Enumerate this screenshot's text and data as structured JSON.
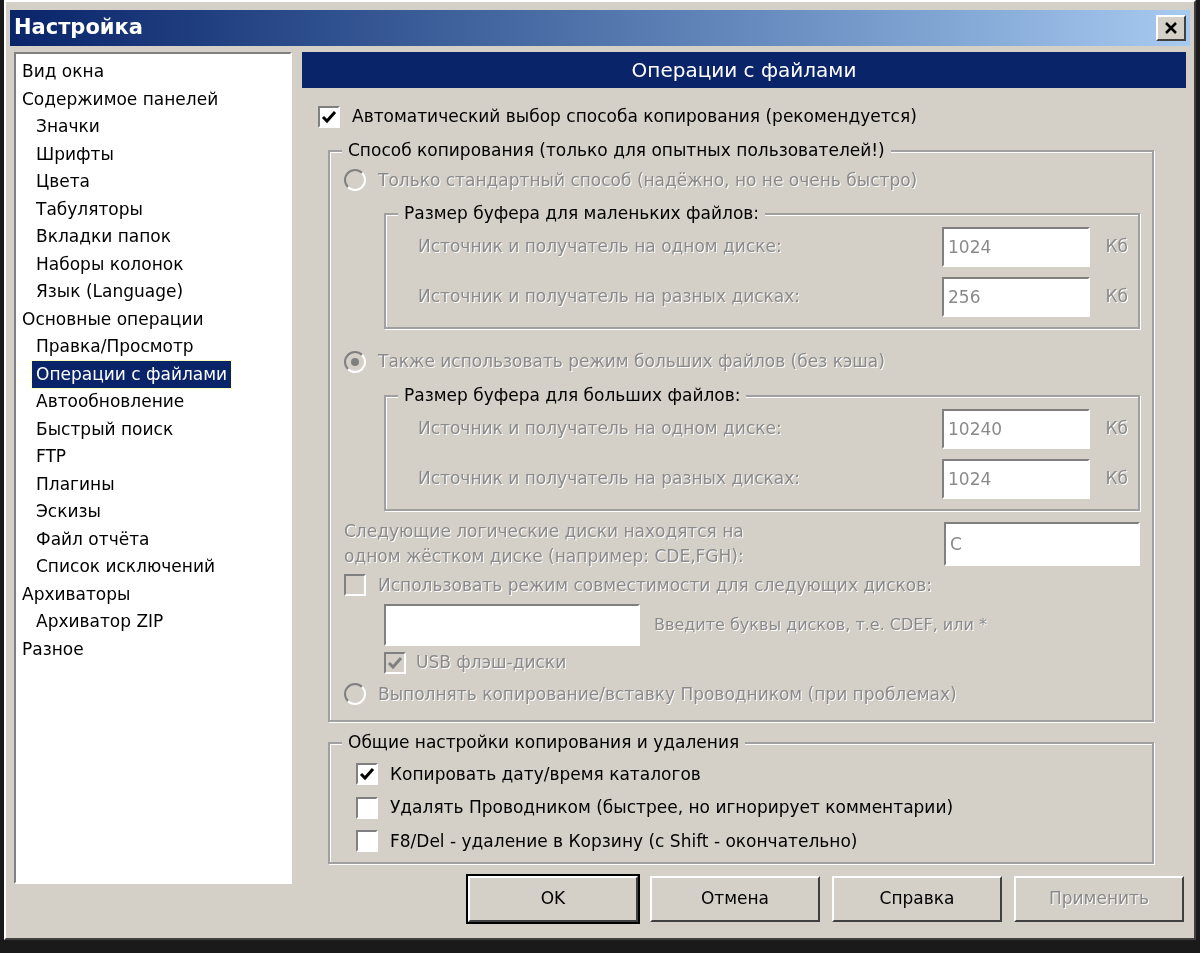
{
  "window": {
    "title": "Настройка"
  },
  "sidebar": {
    "items": [
      {
        "label": "Вид окна",
        "selected": false
      },
      {
        "label": "Содержимое панелей",
        "selected": false,
        "children": [
          {
            "label": "Значки",
            "selected": false
          },
          {
            "label": "Шрифты",
            "selected": false
          },
          {
            "label": "Цвета",
            "selected": false
          },
          {
            "label": "Табуляторы",
            "selected": false
          },
          {
            "label": "Вкладки папок",
            "selected": false
          },
          {
            "label": "Наборы колонок",
            "selected": false
          },
          {
            "label": "Язык (Language)",
            "selected": false
          }
        ]
      },
      {
        "label": "Основные операции",
        "selected": false,
        "children": [
          {
            "label": "Правка/Просмотр",
            "selected": false
          },
          {
            "label": "Операции с файлами",
            "selected": true
          },
          {
            "label": "Автообновление",
            "selected": false
          },
          {
            "label": "Быстрый поиск",
            "selected": false
          },
          {
            "label": "FTP",
            "selected": false
          },
          {
            "label": "Плагины",
            "selected": false
          },
          {
            "label": "Эскизы",
            "selected": false
          },
          {
            "label": "Файл отчёта",
            "selected": false
          },
          {
            "label": "Список исключений",
            "selected": false
          }
        ]
      },
      {
        "label": "Архиваторы",
        "selected": false,
        "children": [
          {
            "label": "Архиватор ZIP",
            "selected": false
          }
        ]
      },
      {
        "label": "Разное",
        "selected": false
      }
    ]
  },
  "panel": {
    "header": "Операции с файлами",
    "auto_copy": {
      "label": "Автоматический выбор способа копирования (рекомендуется)",
      "checked": true
    },
    "copy_method": {
      "title": "Способ копирования (только для опытных пользователей!)",
      "disabled": true,
      "standard": {
        "label": "Только стандартный способ (надёжно, но не очень быстро)",
        "selected": false
      },
      "small_buffer": {
        "title": "Размер буфера для маленьких файлов:",
        "rows": [
          {
            "label": "Источник и получатель на одном диске:",
            "value": "1024",
            "unit": "Кб"
          },
          {
            "label": "Источник и получатель на разных дисках:",
            "value": "256",
            "unit": "Кб"
          }
        ]
      },
      "large_files": {
        "label": "Также использовать режим больших файлов (без кэша)",
        "selected": true
      },
      "large_buffer": {
        "title": "Размер буфера для больших файлов:",
        "rows": [
          {
            "label": "Источник и получатель на одном диске:",
            "value": "10240",
            "unit": "Кб"
          },
          {
            "label": "Источник и получатель на разных дисках:",
            "value": "1024",
            "unit": "Кб"
          }
        ]
      },
      "same_disk": {
        "label": "Следующие логические диски находятся на одном жёстком диске (например: CDE,FGH):",
        "value": "C"
      },
      "compat": {
        "label": "Использовать режим совместимости для следующих дисков:",
        "checked": false,
        "hint": "Введите буквы дисков, т.е. CDEF, или *"
      },
      "usb": {
        "label": "USB флэш-диски",
        "checked": true
      },
      "explorer": {
        "label": "Выполнять копирование/вставку Проводником (при проблемах)",
        "selected": false
      }
    },
    "general": {
      "title": "Общие настройки копирования и удаления",
      "options": [
        {
          "label": "Копировать дату/время каталогов",
          "checked": true
        },
        {
          "label": "Удалять Проводником (быстрее, но игнорирует комментарии)",
          "checked": false
        },
        {
          "label": "F8/Del - удаление в Корзину (с Shift - окончательно)",
          "checked": false
        }
      ]
    }
  },
  "buttons": [
    {
      "label": "OK",
      "default": true,
      "disabled": false
    },
    {
      "label": "Отмена",
      "default": false,
      "disabled": false
    },
    {
      "label": "Справка",
      "default": false,
      "disabled": false
    },
    {
      "label": "Применить",
      "default": false,
      "disabled": true
    }
  ]
}
